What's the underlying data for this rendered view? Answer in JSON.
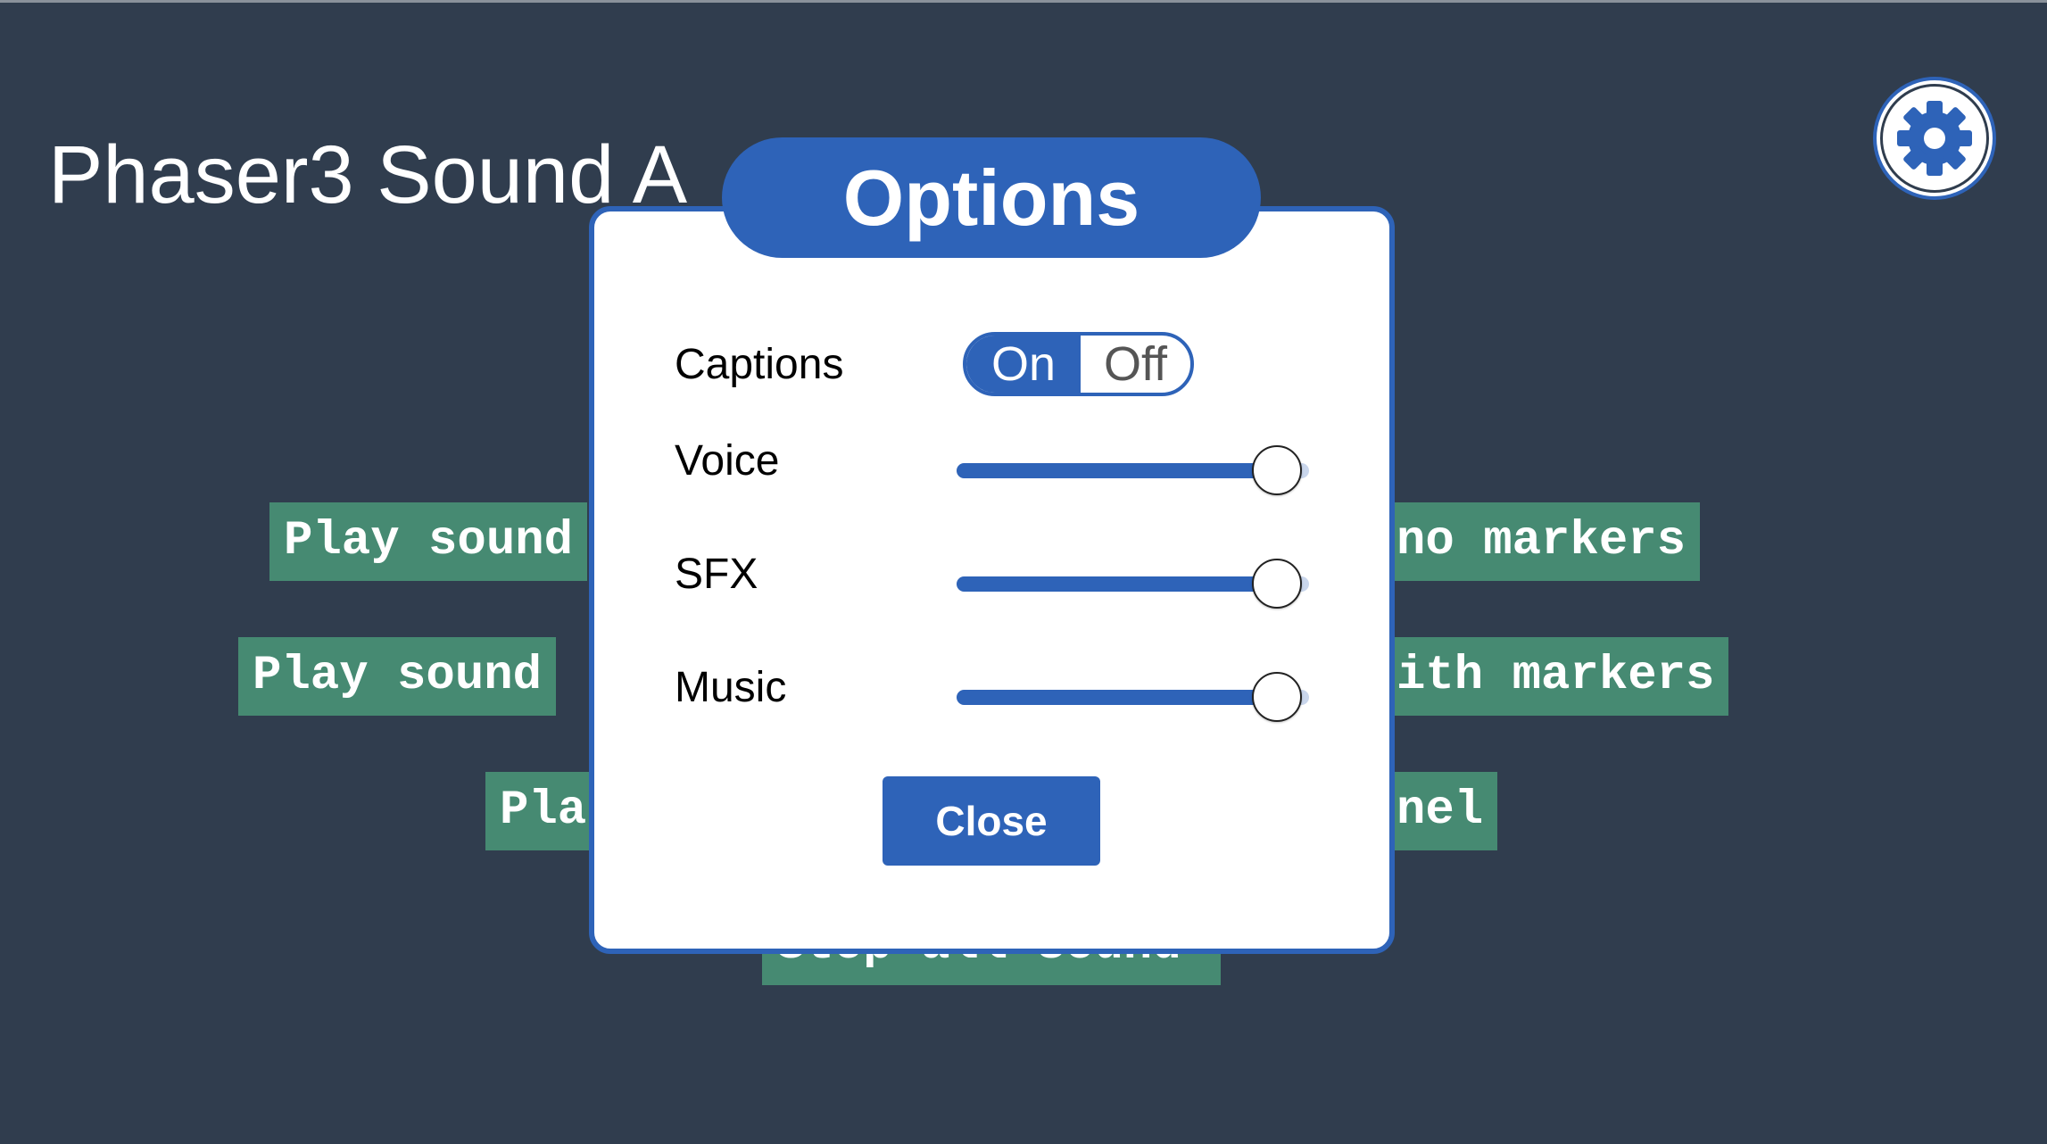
{
  "page": {
    "title": "Phaser3 Sound A"
  },
  "menu": {
    "items": [
      {
        "label": "Play sound"
      },
      {
        "label": "no markers"
      },
      {
        "label": "Play sound"
      },
      {
        "label": "ith markers"
      },
      {
        "label": "Pla"
      },
      {
        "label": "nel"
      },
      {
        "label": "Stop all sound"
      }
    ]
  },
  "settings_button": {
    "icon": "gear-icon"
  },
  "options": {
    "title": "Options",
    "captions": {
      "label": "Captions",
      "on_label": "On",
      "off_label": "Off",
      "value": "On"
    },
    "voice": {
      "label": "Voice",
      "value": 1.0
    },
    "sfx": {
      "label": "SFX",
      "value": 1.0
    },
    "music": {
      "label": "Music",
      "value": 1.0
    },
    "close_label": "Close"
  },
  "colors": {
    "background": "#303d4e",
    "accent": "#2e63b8",
    "menu_button": "#468a72"
  }
}
